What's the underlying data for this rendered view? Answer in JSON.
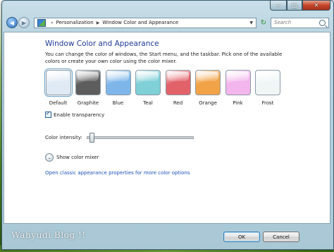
{
  "window": {
    "caption_buttons": {
      "minimize_icon": "minimize-icon",
      "maximize_icon": "maximize-icon",
      "close_icon": "close-icon"
    }
  },
  "nav": {
    "breadcrumb": [
      "Personalization",
      "Window Color and Appearance"
    ],
    "search_placeholder": "Search"
  },
  "page": {
    "title": "Window Color and Appearance",
    "description": "You can change the color of windows, the Start menu, and the taskbar. Pick one of the available colors or create your own color using the color mixer.",
    "swatches": [
      {
        "label": "Default",
        "color": "#dfeaf4",
        "selected": true
      },
      {
        "label": "Graphite",
        "color": "#5d5d5d"
      },
      {
        "label": "Blue",
        "color": "#7eb6ea"
      },
      {
        "label": "Teal",
        "color": "#7fd0d7"
      },
      {
        "label": "Red",
        "color": "#e2626a"
      },
      {
        "label": "Orange",
        "color": "#f2a348"
      },
      {
        "label": "Pink",
        "color": "#f3b6ec"
      },
      {
        "label": "Frost",
        "color": "#f0f6f6"
      }
    ],
    "transparency": {
      "label": "Enable transparency",
      "checked": true
    },
    "intensity": {
      "label": "Color intensity:",
      "value": 0.02
    },
    "mixer_label": "Show color mixer",
    "classic_link": "Open classic appearance properties for more color options"
  },
  "footer": {
    "ok_label": "OK",
    "cancel_label": "Cancel"
  },
  "watermark": "Wahyudi Blog !!"
}
